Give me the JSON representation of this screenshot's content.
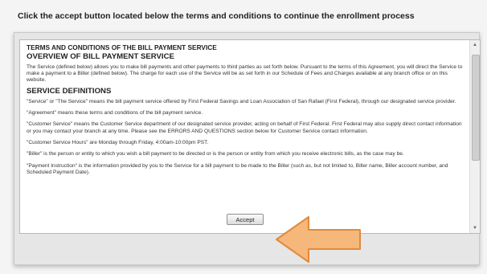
{
  "instruction": "Click the accept button located below the terms and conditions to continue the enrollment process",
  "terms": {
    "doc_title": "TERMS AND CONDITIONS OF THE BILL PAYMENT SERVICE",
    "overview_heading": "OVERVIEW OF BILL PAYMENT SERVICE",
    "overview_text": "The Service (defined below) allows you to make bill payments and other payments to third parties as set forth below. Pursuant to the terms of this Agreement, you will direct the Service to make a payment to a Biller (defined below). The charge for each use of the Service will be as set forth in our Schedule of Fees and Charges available at any branch office or on this website.",
    "definitions_heading": "SERVICE DEFINITIONS",
    "definitions": [
      "\"Service\" or \"The Service\" means the bill payment service offered by First Federal Savings and Loan Association of San Rafael (First Federal), through our designated service provider.",
      "\"Agreement\" means these terms and conditions of the bill payment service.",
      "\"Customer Service\" means the Customer Service department of our designated service provider, acting on behalf of First Federal. First Federal may also supply direct contact information or you may contact your branch at any time. Please see the ERRORS AND QUESTIONS section below for Customer Service contact information.",
      "\"Customer Service Hours\" are Monday through Friday, 4:00am-10:00pm PST.",
      "\"Biller\" is the person or entity to which you wish a bill payment to be directed or is the person or entity from which you receive electronic bills, as the case may be.",
      "\"Payment Instruction\" is the information provided by you to the Service for a bill payment to be made to the Biller (such as, but not limited to, Biller name, Biller account number, and Scheduled Payment Date)."
    ]
  },
  "accept_button": "Accept",
  "colors": {
    "arrow_fill": "#f5b77a",
    "arrow_stroke": "#e08a3c"
  },
  "icons": {
    "arrow_callout": "left-arrow-icon"
  }
}
